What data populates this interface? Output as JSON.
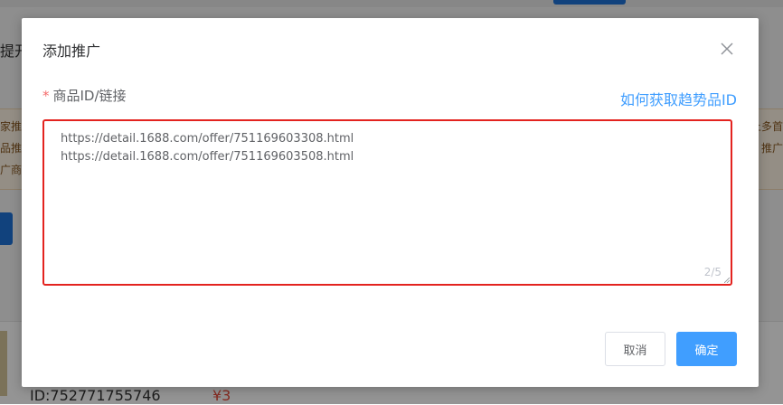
{
  "background": {
    "left_text": "提开",
    "warn_left_lines": [
      "家推广",
      "品推广",
      "广商品"
    ],
    "warn_right_lines": [
      "上多首",
      "推广",
      ""
    ],
    "product_id": "ID:752771755746",
    "product_price": "¥3"
  },
  "dialog": {
    "title": "添加推广",
    "close_icon": "close-icon",
    "field": {
      "required_mark": "*",
      "label": "商品ID/链接",
      "help_link": "如何获取趋势品ID",
      "value": "https://detail.1688.com/offer/751169603308.html\nhttps://detail.1688.com/offer/751169603508.html",
      "counter": "2/5"
    },
    "buttons": {
      "cancel": "取消",
      "confirm": "确定"
    }
  },
  "colors": {
    "primary": "#409eff",
    "highlight_border": "#e3231f",
    "required": "#f56c6c"
  }
}
